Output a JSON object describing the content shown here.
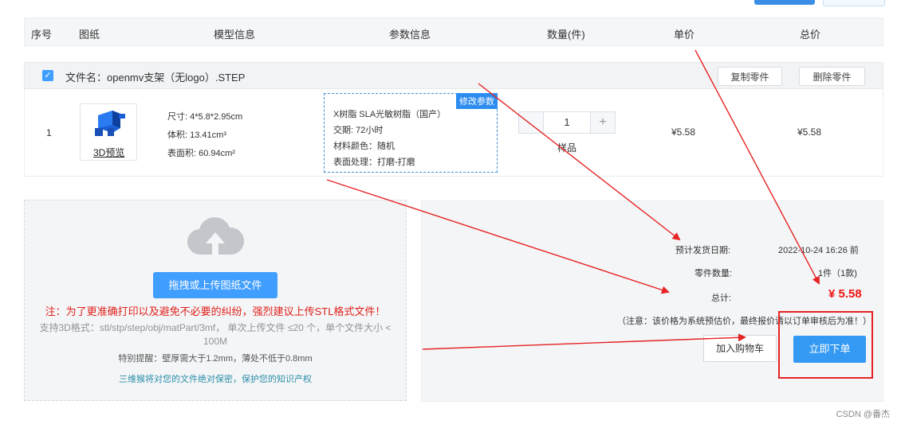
{
  "table_headers": [
    "序号",
    "图纸",
    "模型信息",
    "参数信息",
    "数量(件)",
    "单价",
    "总价"
  ],
  "file": {
    "name_label": "文件名：openmv支架（无logo）.STEP",
    "copy_button": "复制零件",
    "delete_button": "删除零件"
  },
  "item": {
    "index": "1",
    "preview_link": "3D预览",
    "model_info": [
      "尺寸: 4*5.8*2.95cm",
      "体积: 13.41cm³",
      "表面积: 60.94cm²"
    ],
    "modify_tag": "修改参数",
    "params": [
      "X树脂   SLA光敏树脂（国产）",
      "交期:   72小时",
      "材料颜色：随机",
      "表面处理：打磨-打磨"
    ],
    "quantity": "1",
    "quantity_note": "样品",
    "unit_price": "¥5.58",
    "total_price": "¥5.58"
  },
  "upload": {
    "button": "拖拽或上传图纸文件",
    "warning": "注：为了更准确打印以及避免不必要的纠纷，强烈建议上传STL格式文件！",
    "formats": "支持3D格式：stl/stp/step/obj/matPart/3mf，  单次上传文件 ≤20 个，单个文件大小 < 100M",
    "tip": "特别提醒：壁厚需大于1.2mm，薄处不低于0.8mm",
    "privacy": "三维猴将对您的文件绝对保密，保护您的知识产权"
  },
  "summary": {
    "ship_date_label": "预计发货日期:",
    "ship_date_value": "2022-10-24 16:26 前",
    "parts_label": "零件数量:",
    "parts_value": "1件（1款)",
    "total_label": "总计:",
    "total_value": "¥ 5.58",
    "disclaimer": "（注意：该价格为系统预估价，最终报价请以订单审核后为准！）",
    "cart_button": "加入购物车",
    "order_button": "立即下单"
  },
  "watermark": "CSDN @番杰",
  "colors": {
    "primary": "#409eff",
    "danger": "#f01414",
    "annotation": "#e52323"
  }
}
